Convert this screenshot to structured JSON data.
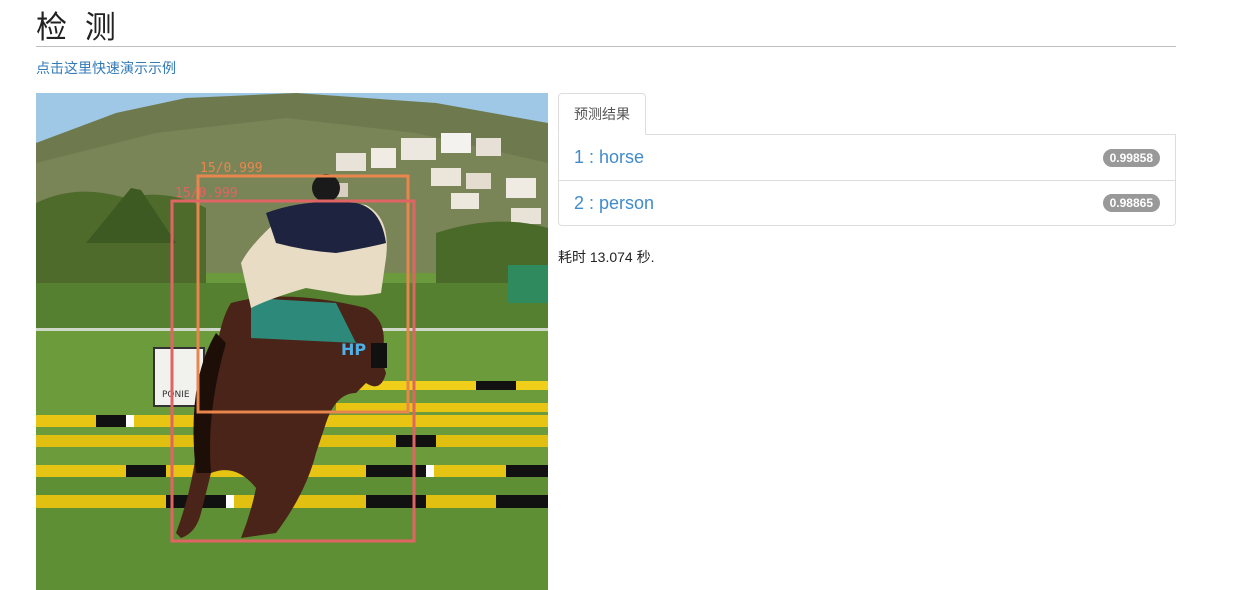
{
  "header": {
    "title": "检 测",
    "demo_link": "点击这里快速演示示例"
  },
  "image": {
    "boxes": [
      {
        "label_text": "15/0.999",
        "color": "#e8864d"
      },
      {
        "label_text": "15/0.999",
        "color": "#e06464"
      }
    ],
    "sign_text": "PONIE",
    "saddle_text": "HP"
  },
  "results": {
    "tab_label": "预测结果",
    "items": [
      {
        "label": "1 : horse",
        "score": "0.99858"
      },
      {
        "label": "2 : person",
        "score": "0.98865"
      }
    ]
  },
  "elapsed_text": "耗时 13.074 秒.",
  "colors": {
    "link": "#337ab7",
    "result_text": "#428bca",
    "badge": "#999999"
  }
}
